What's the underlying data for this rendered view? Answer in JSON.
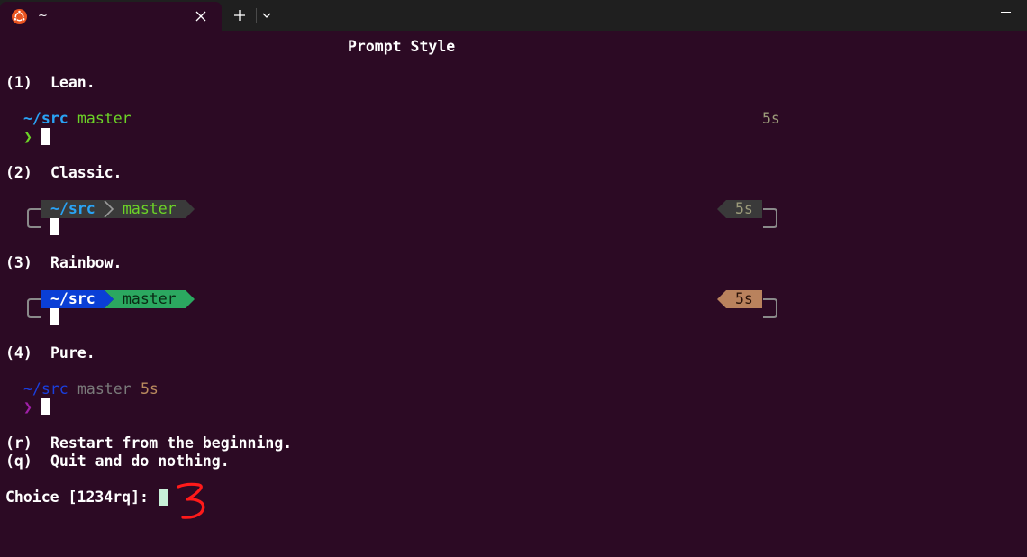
{
  "tab": {
    "title": "~"
  },
  "icons": {
    "app": "ubuntu-logo-icon",
    "close": "close-icon",
    "new_tab": "plus-icon",
    "dropdown": "chevron-down-icon",
    "minimize": "minimize-icon"
  },
  "colors": {
    "terminal_bg": "#2c0a24",
    "titlebar_bg": "#1f1f1f",
    "dir_blue": "#2aa3f5",
    "branch_green": "#6cd327",
    "lean_time": "#9c9b7a",
    "classic_seg": "#3a3a3a",
    "rainbow_dir_bg": "#0a3fd6",
    "rainbow_branch_bg": "#2ba860",
    "rainbow_time_bg": "#b9825d",
    "pure_dir": "#1a3fdf",
    "pure_branch": "#7a7a7a",
    "pure_time": "#b98a5e",
    "pure_prompt": "#a020a8",
    "annotation_red": "#ff1a1a"
  },
  "terminal": {
    "heading": "Prompt Style",
    "options": [
      {
        "key": "(1)",
        "label": "Lean."
      },
      {
        "key": "(2)",
        "label": "Classic."
      },
      {
        "key": "(3)",
        "label": "Rainbow."
      },
      {
        "key": "(4)",
        "label": "Pure."
      }
    ],
    "preview": {
      "dir": "~/src",
      "branch": "master",
      "duration": "5s",
      "prompt_char": "❯"
    },
    "extra_options": [
      {
        "key": "(r)",
        "label": "Restart from the beginning."
      },
      {
        "key": "(q)",
        "label": "Quit and do nothing."
      }
    ],
    "choice_prompt": "Choice [1234rq]:",
    "annotation": "3"
  }
}
